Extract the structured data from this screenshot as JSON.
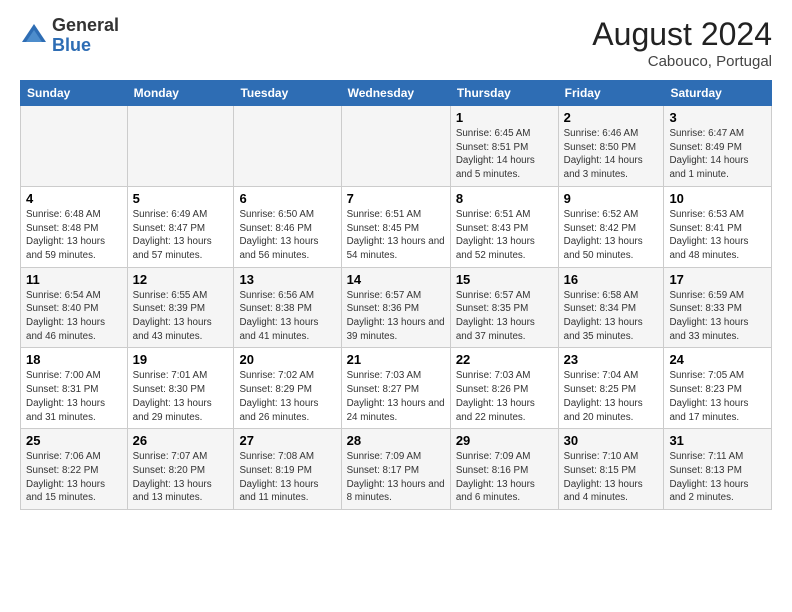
{
  "header": {
    "logo_general": "General",
    "logo_blue": "Blue",
    "month_title": "August 2024",
    "location": "Cabouco, Portugal"
  },
  "days_of_week": [
    "Sunday",
    "Monday",
    "Tuesday",
    "Wednesday",
    "Thursday",
    "Friday",
    "Saturday"
  ],
  "weeks": [
    [
      {
        "day": "",
        "info": ""
      },
      {
        "day": "",
        "info": ""
      },
      {
        "day": "",
        "info": ""
      },
      {
        "day": "",
        "info": ""
      },
      {
        "day": "1",
        "info": "Sunrise: 6:45 AM\nSunset: 8:51 PM\nDaylight: 14 hours\nand 5 minutes."
      },
      {
        "day": "2",
        "info": "Sunrise: 6:46 AM\nSunset: 8:50 PM\nDaylight: 14 hours\nand 3 minutes."
      },
      {
        "day": "3",
        "info": "Sunrise: 6:47 AM\nSunset: 8:49 PM\nDaylight: 14 hours\nand 1 minute."
      }
    ],
    [
      {
        "day": "4",
        "info": "Sunrise: 6:48 AM\nSunset: 8:48 PM\nDaylight: 13 hours\nand 59 minutes."
      },
      {
        "day": "5",
        "info": "Sunrise: 6:49 AM\nSunset: 8:47 PM\nDaylight: 13 hours\nand 57 minutes."
      },
      {
        "day": "6",
        "info": "Sunrise: 6:50 AM\nSunset: 8:46 PM\nDaylight: 13 hours\nand 56 minutes."
      },
      {
        "day": "7",
        "info": "Sunrise: 6:51 AM\nSunset: 8:45 PM\nDaylight: 13 hours\nand 54 minutes."
      },
      {
        "day": "8",
        "info": "Sunrise: 6:51 AM\nSunset: 8:43 PM\nDaylight: 13 hours\nand 52 minutes."
      },
      {
        "day": "9",
        "info": "Sunrise: 6:52 AM\nSunset: 8:42 PM\nDaylight: 13 hours\nand 50 minutes."
      },
      {
        "day": "10",
        "info": "Sunrise: 6:53 AM\nSunset: 8:41 PM\nDaylight: 13 hours\nand 48 minutes."
      }
    ],
    [
      {
        "day": "11",
        "info": "Sunrise: 6:54 AM\nSunset: 8:40 PM\nDaylight: 13 hours\nand 46 minutes."
      },
      {
        "day": "12",
        "info": "Sunrise: 6:55 AM\nSunset: 8:39 PM\nDaylight: 13 hours\nand 43 minutes."
      },
      {
        "day": "13",
        "info": "Sunrise: 6:56 AM\nSunset: 8:38 PM\nDaylight: 13 hours\nand 41 minutes."
      },
      {
        "day": "14",
        "info": "Sunrise: 6:57 AM\nSunset: 8:36 PM\nDaylight: 13 hours\nand 39 minutes."
      },
      {
        "day": "15",
        "info": "Sunrise: 6:57 AM\nSunset: 8:35 PM\nDaylight: 13 hours\nand 37 minutes."
      },
      {
        "day": "16",
        "info": "Sunrise: 6:58 AM\nSunset: 8:34 PM\nDaylight: 13 hours\nand 35 minutes."
      },
      {
        "day": "17",
        "info": "Sunrise: 6:59 AM\nSunset: 8:33 PM\nDaylight: 13 hours\nand 33 minutes."
      }
    ],
    [
      {
        "day": "18",
        "info": "Sunrise: 7:00 AM\nSunset: 8:31 PM\nDaylight: 13 hours\nand 31 minutes."
      },
      {
        "day": "19",
        "info": "Sunrise: 7:01 AM\nSunset: 8:30 PM\nDaylight: 13 hours\nand 29 minutes."
      },
      {
        "day": "20",
        "info": "Sunrise: 7:02 AM\nSunset: 8:29 PM\nDaylight: 13 hours\nand 26 minutes."
      },
      {
        "day": "21",
        "info": "Sunrise: 7:03 AM\nSunset: 8:27 PM\nDaylight: 13 hours\nand 24 minutes."
      },
      {
        "day": "22",
        "info": "Sunrise: 7:03 AM\nSunset: 8:26 PM\nDaylight: 13 hours\nand 22 minutes."
      },
      {
        "day": "23",
        "info": "Sunrise: 7:04 AM\nSunset: 8:25 PM\nDaylight: 13 hours\nand 20 minutes."
      },
      {
        "day": "24",
        "info": "Sunrise: 7:05 AM\nSunset: 8:23 PM\nDaylight: 13 hours\nand 17 minutes."
      }
    ],
    [
      {
        "day": "25",
        "info": "Sunrise: 7:06 AM\nSunset: 8:22 PM\nDaylight: 13 hours\nand 15 minutes."
      },
      {
        "day": "26",
        "info": "Sunrise: 7:07 AM\nSunset: 8:20 PM\nDaylight: 13 hours\nand 13 minutes."
      },
      {
        "day": "27",
        "info": "Sunrise: 7:08 AM\nSunset: 8:19 PM\nDaylight: 13 hours\nand 11 minutes."
      },
      {
        "day": "28",
        "info": "Sunrise: 7:09 AM\nSunset: 8:17 PM\nDaylight: 13 hours\nand 8 minutes."
      },
      {
        "day": "29",
        "info": "Sunrise: 7:09 AM\nSunset: 8:16 PM\nDaylight: 13 hours\nand 6 minutes."
      },
      {
        "day": "30",
        "info": "Sunrise: 7:10 AM\nSunset: 8:15 PM\nDaylight: 13 hours\nand 4 minutes."
      },
      {
        "day": "31",
        "info": "Sunrise: 7:11 AM\nSunset: 8:13 PM\nDaylight: 13 hours\nand 2 minutes."
      }
    ]
  ]
}
